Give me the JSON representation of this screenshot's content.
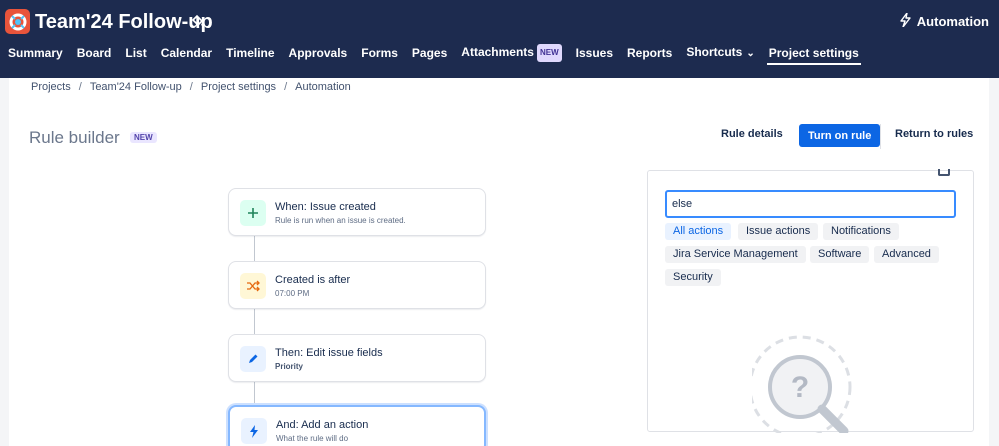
{
  "header": {
    "project_title": "Team'24 Follow-up",
    "automation_label": "Automation",
    "nav": [
      {
        "label": "Summary"
      },
      {
        "label": "Board"
      },
      {
        "label": "List"
      },
      {
        "label": "Calendar"
      },
      {
        "label": "Timeline"
      },
      {
        "label": "Approvals"
      },
      {
        "label": "Forms"
      },
      {
        "label": "Pages"
      },
      {
        "label": "Attachments",
        "badge": "NEW"
      },
      {
        "label": "Issues"
      },
      {
        "label": "Reports"
      },
      {
        "label": "Shortcuts"
      },
      {
        "label": "Project settings"
      }
    ]
  },
  "breadcrumb": [
    "Projects",
    "Team'24 Follow-up",
    "Project settings",
    "Automation"
  ],
  "page": {
    "title": "Rule builder",
    "title_badge": "NEW",
    "rule_details": "Rule details",
    "turn_on_rule": "Turn on rule",
    "return_to_rules": "Return to rules"
  },
  "steps": [
    {
      "title": "When: Issue created",
      "subtitle": "Rule is run when an issue is created.",
      "icon": "plus-icon"
    },
    {
      "title": "Created is after",
      "subtitle": "07:00 PM",
      "icon": "shuffle-icon"
    },
    {
      "title": "Then: Edit issue fields",
      "subtitle": "Priority",
      "icon": "pencil-icon"
    },
    {
      "title": "And: Add an action",
      "subtitle": "What the rule will do",
      "icon": "bolt-icon"
    }
  ],
  "panel": {
    "search_value": "else",
    "categories": [
      "All actions",
      "Issue actions",
      "Notifications",
      "Jira Service Management",
      "Software",
      "Advanced",
      "Security"
    ],
    "selected_category": "All actions"
  },
  "colors": {
    "header_bg": "#1d2b4f",
    "primary": "#0c66e4",
    "logo": "#e8543b"
  }
}
